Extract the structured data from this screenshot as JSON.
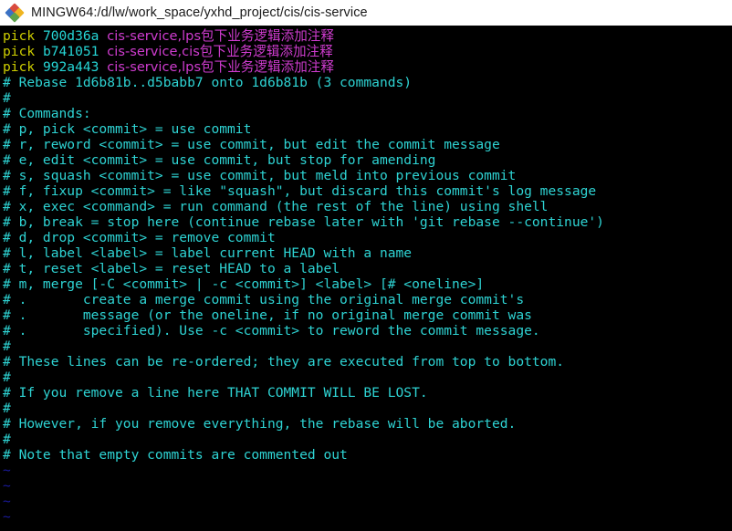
{
  "window": {
    "title": "MINGW64:/d/lw/work_space/yxhd_project/cis/cis-service",
    "icon": "mingw-diamond-icon"
  },
  "colors": {
    "background": "#000000",
    "titlebar_background": "#ffffff",
    "command_keyword": "#cdcd00",
    "commit_hash": "#26d6d6",
    "commit_message": "#cf3ccf",
    "comment": "#2ed3d3",
    "tilde": "#1a1a9e"
  },
  "editor": {
    "todo_entries": [
      {
        "command": "pick",
        "hash": "700d36a",
        "message": "cis-service,lps包下业务逻辑添加注释"
      },
      {
        "command": "pick",
        "hash": "b741051",
        "message": "cis-service,cis包下业务逻辑添加注释"
      },
      {
        "command": "pick",
        "hash": "992a443",
        "message": "cis-service,lps包下业务逻辑添加注释"
      }
    ],
    "comments": [
      "# Rebase 1d6b81b..d5babb7 onto 1d6b81b (3 commands)",
      "#",
      "# Commands:",
      "# p, pick <commit> = use commit",
      "# r, reword <commit> = use commit, but edit the commit message",
      "# e, edit <commit> = use commit, but stop for amending",
      "# s, squash <commit> = use commit, but meld into previous commit",
      "# f, fixup <commit> = like \"squash\", but discard this commit's log message",
      "# x, exec <command> = run command (the rest of the line) using shell",
      "# b, break = stop here (continue rebase later with 'git rebase --continue')",
      "# d, drop <commit> = remove commit",
      "# l, label <label> = label current HEAD with a name",
      "# t, reset <label> = reset HEAD to a label",
      "# m, merge [-C <commit> | -c <commit>] <label> [# <oneline>]",
      "# .       create a merge commit using the original merge commit's",
      "# .       message (or the oneline, if no original merge commit was",
      "# .       specified). Use -c <commit> to reword the commit message.",
      "#",
      "# These lines can be re-ordered; they are executed from top to bottom.",
      "#",
      "# If you remove a line here THAT COMMIT WILL BE LOST.",
      "#",
      "# However, if you remove everything, the rebase will be aborted.",
      "#",
      "# Note that empty commits are commented out"
    ],
    "empty_line_markers": [
      "~",
      "~",
      "~",
      "~"
    ]
  }
}
